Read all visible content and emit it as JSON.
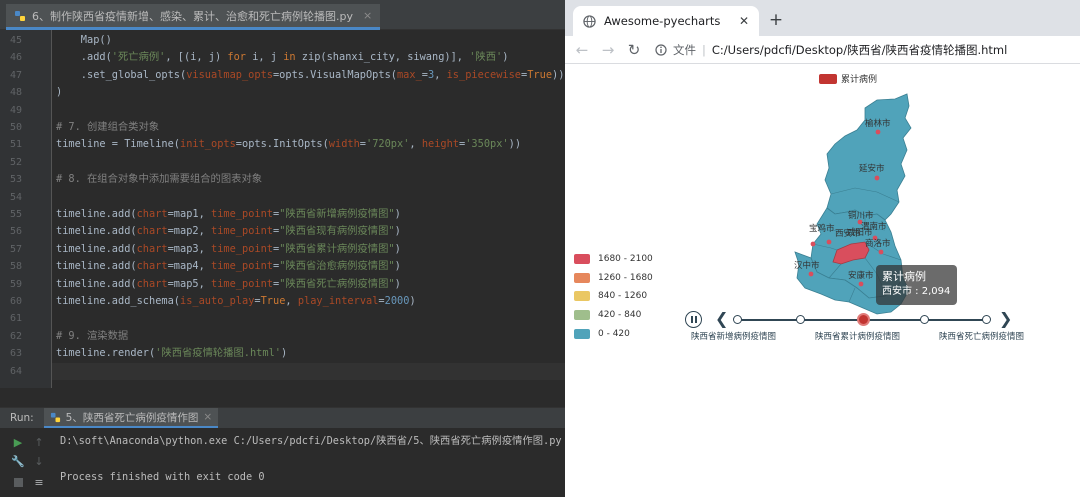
{
  "ide": {
    "editor_tab": {
      "title": "6、制作陕西省疫情新增、感染、累计、治愈和死亡病例轮播图.py",
      "close": "×"
    },
    "line_numbers": [
      "45",
      "46",
      "47",
      "48",
      "49",
      "50",
      "51",
      "52",
      "53",
      "54",
      "55",
      "56",
      "57",
      "58",
      "59",
      "60",
      "61",
      "62",
      "63",
      "64"
    ],
    "run_panel": {
      "label": "Run:",
      "tab_title": "5、陕西省死亡病例疫情作图",
      "tab_close": "×",
      "command": "D:\\soft\\Anaconda\\python.exe C:/Users/pdcfi/Desktop/陕西省/5、陕西省死亡病例疫情作图.py",
      "exit_message": "Process finished with exit code 0"
    }
  },
  "browser": {
    "tab_title": "Awesome-pyecharts",
    "tab_close": "✕",
    "new_tab": "+",
    "address": {
      "file_label": "文件",
      "separator": "|",
      "url": "C:/Users/pdcfi/Desktop/陕西省/陕西省疫情轮播图.html"
    }
  },
  "chart_data": {
    "type": "map",
    "legend": [
      "累计病例"
    ],
    "series": [
      {
        "name": "累计病例",
        "highlighted": {
          "city": "西安市",
          "value": "2,094"
        }
      }
    ],
    "cities": [
      "榆林市",
      "延安市",
      "铜川市",
      "渭南市",
      "咸阳市",
      "宝鸡市",
      "西安市",
      "商洛市",
      "汉中市",
      "安康市"
    ],
    "visual_map": {
      "pieces": [
        {
          "label": "1680 - 2100",
          "color": "#d94e5d"
        },
        {
          "label": "1260 - 1680",
          "color": "#e6875c"
        },
        {
          "label": "840 - 1260",
          "color": "#eac763"
        },
        {
          "label": "420 - 840",
          "color": "#9fbe8c"
        },
        {
          "label": "0 - 420",
          "color": "#50a3ba"
        }
      ]
    },
    "tooltip": {
      "title": "累计病例",
      "text": "西安市 : 2,094"
    },
    "timeline": {
      "labels": [
        "陕西省新增病例疫情图",
        "陕西省累计病例疫情图",
        "陕西省死亡病例疫情图"
      ],
      "points": 5,
      "active_index": 2
    }
  },
  "colors": {
    "map_fill": "#50a3ba",
    "highlight": "#d94e5d",
    "timeline": "#304654"
  }
}
